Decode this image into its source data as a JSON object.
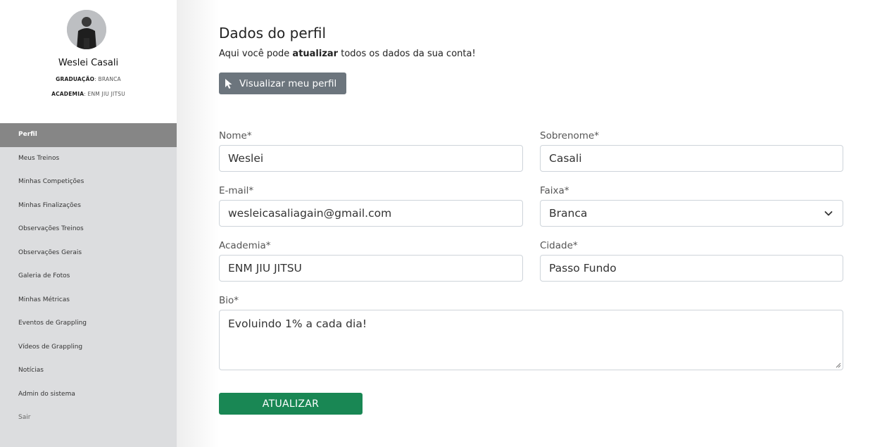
{
  "user": {
    "name": "Weslei Casali",
    "graduation_label": "GRADUAÇÃO",
    "graduation_value": ": BRANCA",
    "academy_label": "ACADEMIA",
    "academy_value": ": ENM JIU JITSU"
  },
  "sidebar": {
    "items": [
      {
        "label": "Perfil",
        "active": true
      },
      {
        "label": "Meus Treinos"
      },
      {
        "label": "Minhas Competições"
      },
      {
        "label": "Minhas Finalizações"
      },
      {
        "label": "Observações Treinos"
      },
      {
        "label": "Observações Gerais"
      },
      {
        "label": "Galeria de Fotos"
      },
      {
        "label": "Minhas Métricas"
      },
      {
        "label": "Eventos de Grappling"
      },
      {
        "label": "Vídeos de Grappling"
      },
      {
        "label": "Notícias"
      },
      {
        "label": "Admin do sistema"
      },
      {
        "label": "Sair"
      }
    ]
  },
  "page": {
    "title": "Dados do perfil",
    "subtitle_prefix": "Aqui você pode ",
    "subtitle_bold": "atualizar",
    "subtitle_suffix": " todos os dados da sua conta!",
    "view_profile_label": "Visualizar meu perfil"
  },
  "form": {
    "first_name": {
      "label": "Nome*",
      "value": "Weslei"
    },
    "last_name": {
      "label": "Sobrenome*",
      "value": "Casali"
    },
    "email": {
      "label": "E-mail*",
      "value": "wesleicasaliagain@gmail.com"
    },
    "belt": {
      "label": "Faixa*",
      "value": "Branca"
    },
    "academy": {
      "label": "Academia*",
      "value": "ENM JIU JITSU"
    },
    "city": {
      "label": "Cidade*",
      "value": "Passo Fundo"
    },
    "bio": {
      "label": "Bio*",
      "value": "Evoluindo 1% a cada dia!"
    },
    "submit_label": "ATUALIZAR"
  },
  "colors": {
    "sidebar_bg": "#dcdddf",
    "active_item": "#868686",
    "secondary_button": "#6c757d",
    "primary_button": "#198754"
  },
  "icons": {
    "view_profile": "cursor-pointer-icon",
    "select": "chevron-down-icon",
    "resize": "resize-handle-icon"
  }
}
